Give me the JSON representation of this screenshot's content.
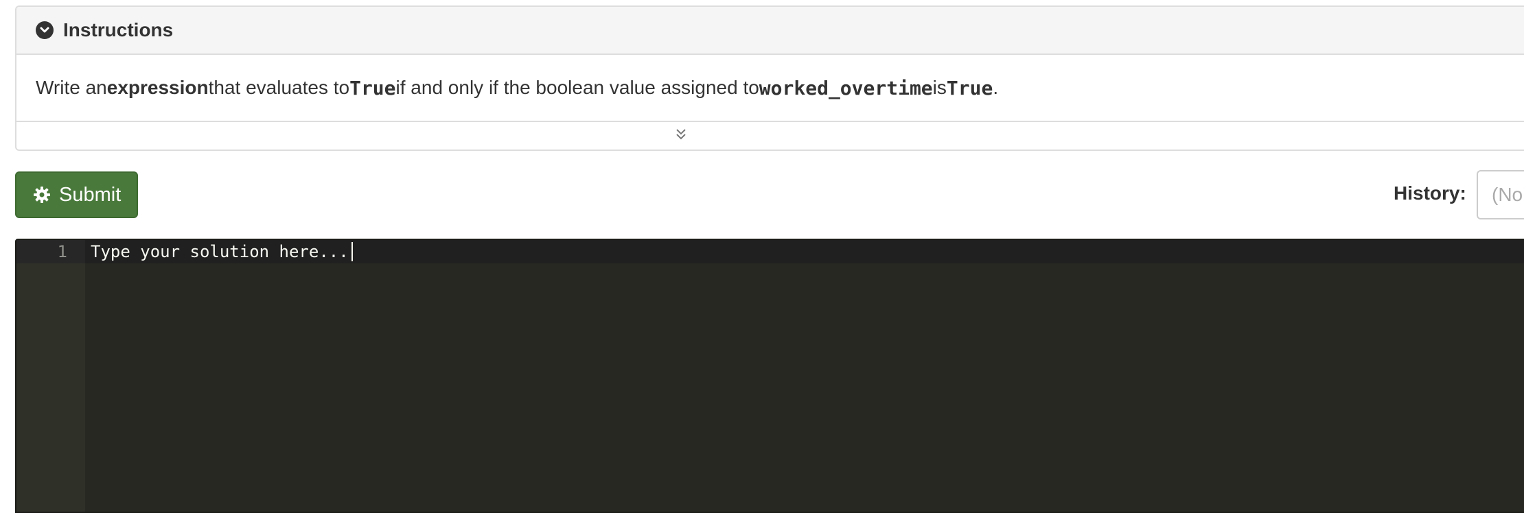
{
  "instructions": {
    "title": "Instructions",
    "text_parts": [
      "Write an ",
      "expression",
      " that evaluates to ",
      "True",
      " if and only if the boolean value assigned to ",
      "worked_overtime",
      " is ",
      "True",
      "."
    ]
  },
  "toolbar": {
    "submit_label": "Submit",
    "history_label": "History:",
    "history_value": "(No"
  },
  "editor": {
    "line_number": "1",
    "placeholder": "Type your solution here..."
  },
  "colors": {
    "submit_bg": "#4a7a3b",
    "editor_bg": "#272822",
    "gutter_bg": "#2f3129"
  }
}
